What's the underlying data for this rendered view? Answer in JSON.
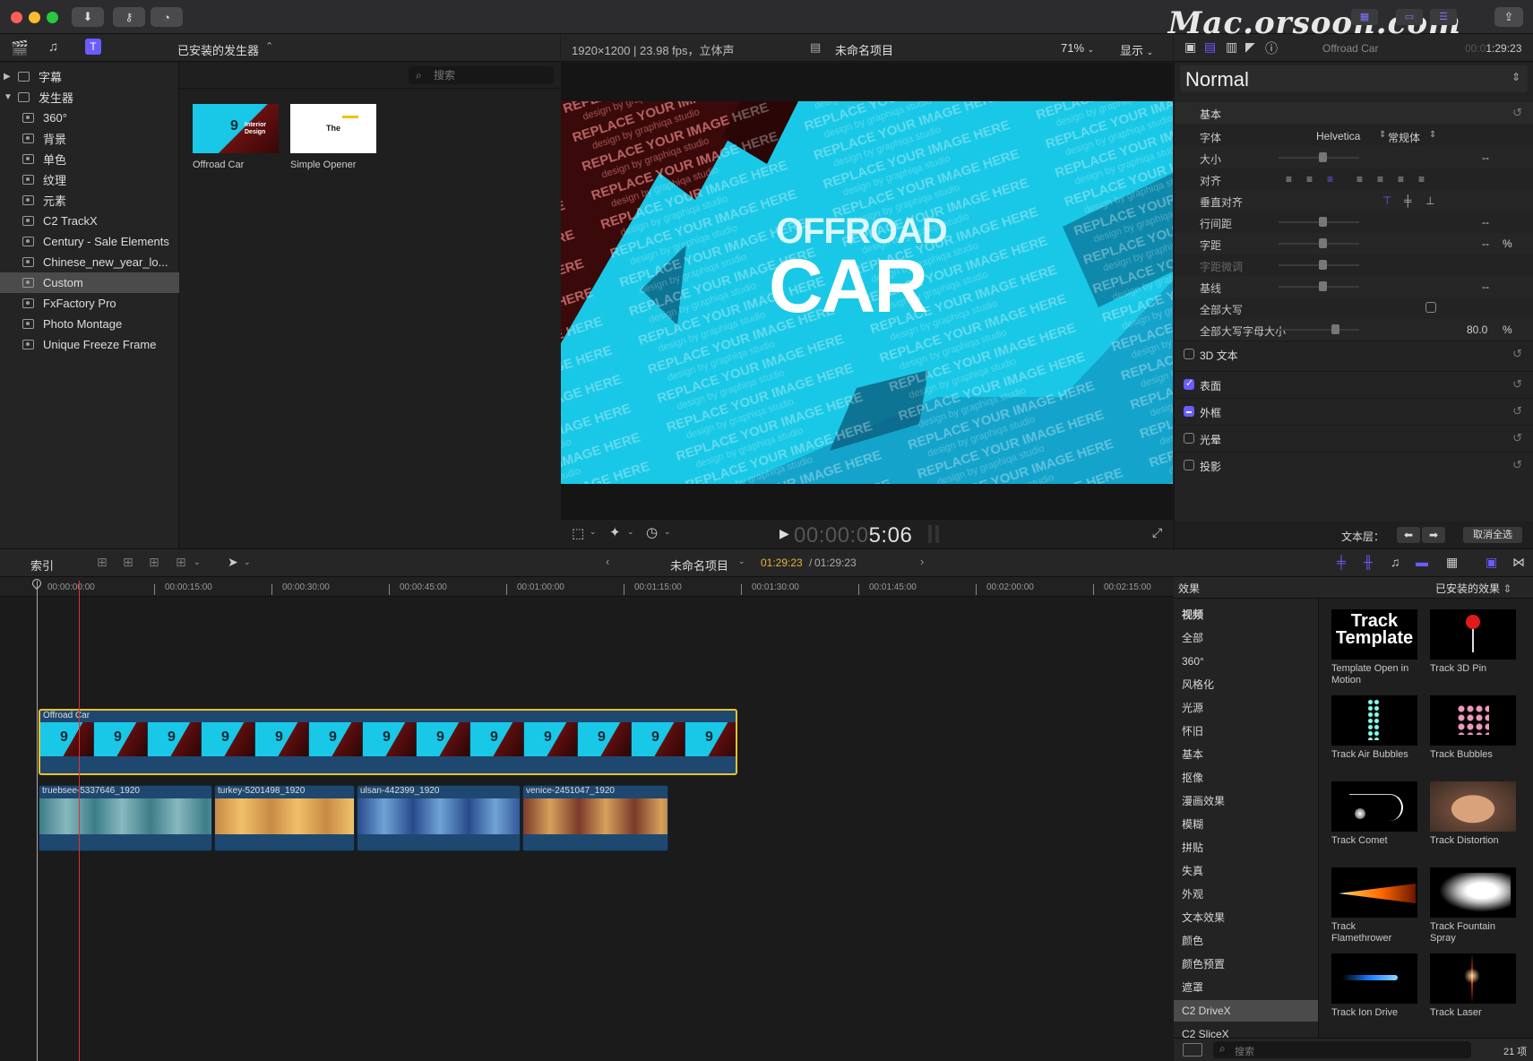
{
  "watermark": "Mac.orsoon.com",
  "colors": {
    "accent": "#6a5cff",
    "yellow_clip_border": "#e8c22a",
    "playhead": "#d33333",
    "canvas_cyan": "#19c8e6"
  },
  "browser": {
    "header_label": "已安装的发生器",
    "search_placeholder": "搜索",
    "sidebar": [
      {
        "label": "字幕",
        "type": "group",
        "expanded": false
      },
      {
        "label": "发生器",
        "type": "group",
        "expanded": true
      },
      {
        "label": "360°"
      },
      {
        "label": "背景"
      },
      {
        "label": "单色"
      },
      {
        "label": "纹理"
      },
      {
        "label": "元素"
      },
      {
        "label": "C2 TrackX"
      },
      {
        "label": "Century - Sale Elements"
      },
      {
        "label": "Chinese_new_year_lo..."
      },
      {
        "label": "Custom",
        "selected": true
      },
      {
        "label": "FxFactory Pro"
      },
      {
        "label": "Photo Montage"
      },
      {
        "label": "Unique Freeze Frame"
      }
    ],
    "generators": [
      {
        "name": "Offroad Car",
        "thumb_text": "Interior Design"
      },
      {
        "name": "Simple Opener",
        "thumb_text": "The"
      }
    ]
  },
  "viewer": {
    "format": "1920×1200 | 23.98 fps，立体声",
    "project": "未命名项目",
    "zoom": "71%",
    "display": "显示",
    "canvas_title_top": "OFFROAD",
    "canvas_title_main": "CAR",
    "canvas_pattern_a": "REPLACE YOUR IMAGE HERE",
    "canvas_pattern_b": "design by graphiqa studio",
    "timecode_dim": "00:00:0",
    "timecode_hi": "5:06"
  },
  "inspector": {
    "clip_name": "Offroad Car",
    "duration": "1:29:23",
    "duration_dim": "00:0",
    "preset": "Normal",
    "section_basic": "基本",
    "rows": {
      "font_label": "字体",
      "font_value": "Helvetica",
      "font_style": "常规体",
      "size_label": "大小",
      "size_value": "--",
      "align_label": "对齐",
      "valign_label": "垂直对齐",
      "line_spacing_label": "行间距",
      "line_spacing_value": "--",
      "tracking_label": "字距",
      "tracking_value": "--",
      "tracking_unit": "%",
      "kerning_label": "字距微调",
      "baseline_label": "基线",
      "baseline_value": "--",
      "all_caps_label": "全部大写",
      "all_caps_size_label": "全部大写字母大小",
      "all_caps_size_value": "80.0",
      "all_caps_size_unit": "%"
    },
    "sections": [
      {
        "label": "3D 文本",
        "state": "off"
      },
      {
        "label": "表面",
        "state": "on"
      },
      {
        "label": "外框",
        "state": "mixed"
      },
      {
        "label": "光晕",
        "state": "off"
      },
      {
        "label": "投影",
        "state": "off"
      }
    ],
    "text_layer_label": "文本层：",
    "deselect_all": "取消全选"
  },
  "timeline": {
    "index_label": "索引",
    "project_name": "未命名项目",
    "position": "01:29:23",
    "duration": "01:29:23",
    "ruler_ticks": [
      "00:00:00:00",
      "00:00:15:00",
      "00:00:30:00",
      "00:00:45:00",
      "00:01:00:00",
      "00:01:15:00",
      "00:01:30:00",
      "00:01:45:00",
      "00:02:00:00",
      "00:02:15:00"
    ],
    "title_clip": "Offroad Car",
    "video_clips": [
      "truebsee-5337646_1920",
      "turkey-5201498_1920",
      "ulsan-442399_1920",
      "venice-2451047_1920"
    ]
  },
  "effects": {
    "header": "效果",
    "installed_label": "已安装的效果",
    "categories": [
      "视频",
      "全部",
      "360°",
      "风格化",
      "光源",
      "怀旧",
      "基本",
      "抠像",
      "漫画效果",
      "模糊",
      "拼贴",
      "失真",
      "外观",
      "文本效果",
      "颜色",
      "颜色预置",
      "遮罩",
      "C2 DriveX",
      "C2 SliceX"
    ],
    "selected_category": "C2 DriveX",
    "items": [
      {
        "name": "Template Open in Motion",
        "thumb": "track-template",
        "thumb_text_1": "Track",
        "thumb_text_2": "Template"
      },
      {
        "name": "Track 3D Pin",
        "thumb": "pin"
      },
      {
        "name": "Track Air Bubbles",
        "thumb": "air-bubbles"
      },
      {
        "name": "Track Bubbles",
        "thumb": "bubbles"
      },
      {
        "name": "Track Comet",
        "thumb": "comet"
      },
      {
        "name": "Track Distortion",
        "thumb": "face"
      },
      {
        "name": "Track Flamethrower",
        "thumb": "flame"
      },
      {
        "name": "Track Fountain Spray",
        "thumb": "spray"
      },
      {
        "name": "Track Ion Drive",
        "thumb": "ion"
      },
      {
        "name": "Track Laser",
        "thumb": "laser"
      }
    ],
    "search_placeholder": "搜索",
    "count": "21 项"
  }
}
